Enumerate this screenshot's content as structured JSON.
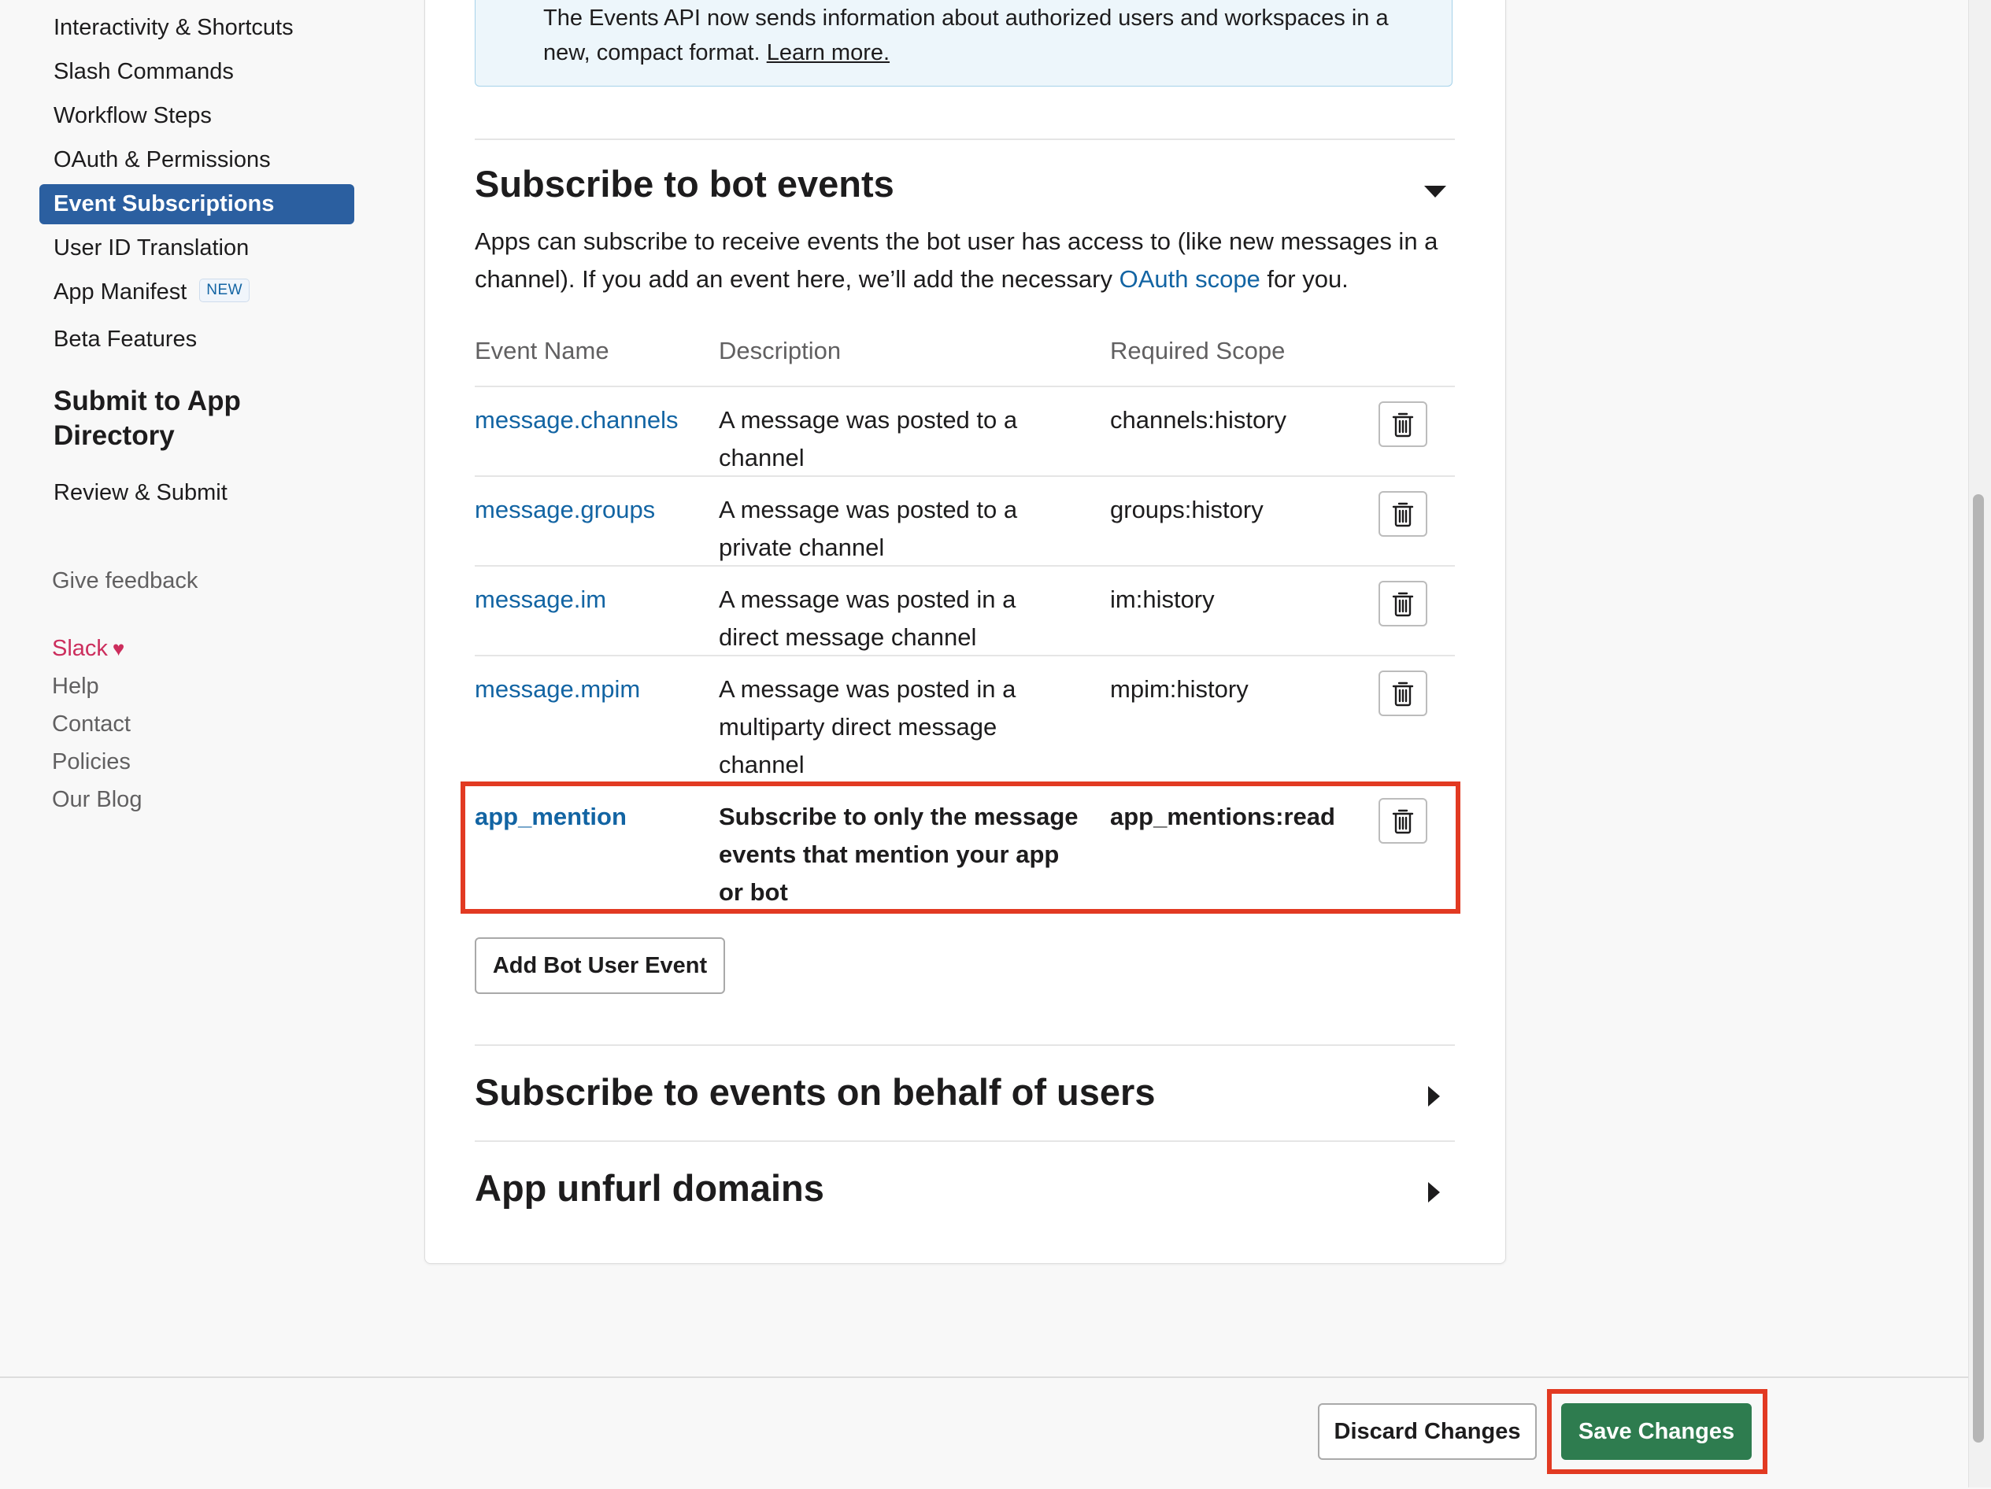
{
  "sidebar": {
    "nav_items": [
      {
        "label": "Interactivity & Shortcuts"
      },
      {
        "label": "Slash Commands"
      },
      {
        "label": "Workflow Steps"
      },
      {
        "label": "OAuth & Permissions"
      },
      {
        "label": "Event Subscriptions",
        "active": true
      },
      {
        "label": "User ID Translation"
      },
      {
        "label": "App Manifest",
        "badge": "NEW"
      },
      {
        "label": "Beta Features"
      }
    ],
    "section_heading": "Submit to App Directory",
    "review_label": "Review & Submit",
    "give_feedback": "Give feedback",
    "footer_links": {
      "slack": "Slack",
      "help": "Help",
      "contact": "Contact",
      "policies": "Policies",
      "blog": "Our Blog"
    }
  },
  "notice": {
    "text": "The Events API now sends information about authorized users and workspaces in a new, compact format.",
    "link": "Learn more."
  },
  "bot_events": {
    "title": "Subscribe to bot events",
    "description_prefix": "Apps can subscribe to receive events the bot user has access to (like new messages in a channel). If you add an event here, we’ll add the necessary ",
    "description_link": "OAuth scope",
    "description_suffix": " for you.",
    "columns": {
      "event": "Event Name",
      "description": "Description",
      "scope": "Required Scope"
    },
    "rows": [
      {
        "event": "message.channels",
        "description": "A message was posted to a channel",
        "scope": "channels:history"
      },
      {
        "event": "message.groups",
        "description": "A message was posted to a private channel",
        "scope": "groups:history"
      },
      {
        "event": "message.im",
        "description": "A message was posted in a direct message channel",
        "scope": "im:history"
      },
      {
        "event": "message.mpim",
        "description": "A message was posted in a multiparty direct message channel",
        "scope": "mpim:history"
      },
      {
        "event": "app_mention",
        "description": "Subscribe to only the message events that mention your app or bot",
        "scope": "app_mentions:read",
        "highlighted": true
      }
    ],
    "add_button": "Add Bot User Event"
  },
  "user_events": {
    "title": "Subscribe to events on behalf of users"
  },
  "unfurl": {
    "title": "App unfurl domains"
  },
  "actions": {
    "discard": "Discard Changes",
    "save": "Save Changes"
  },
  "colors": {
    "active_nav": "#2b5fa0",
    "link": "#1264a3",
    "save_button": "#2e7c4f",
    "highlight": "#e23a22",
    "slack_red": "#cc2e5d"
  }
}
